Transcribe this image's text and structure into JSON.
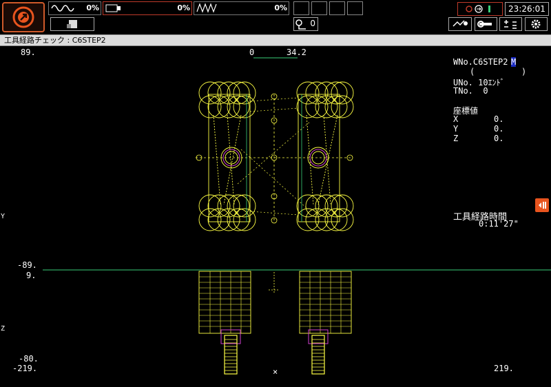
{
  "topbar": {
    "meter1_pct": "0%",
    "meter2_pct": "0%",
    "meter3_pct": "0%",
    "counter": "0",
    "clock": "23:26:01",
    "icons": [
      "program-start-icon",
      "sine-wave-icon",
      "spindle-icon",
      "zigzag-icon",
      "paper-icon",
      "key-icon",
      "status-icon",
      "navigation-icon",
      "wrench-icon",
      "calculator-icon",
      "gear-icon"
    ]
  },
  "titlebar": {
    "title": "工具経路チェック : C6STEP2"
  },
  "graph": {
    "top_left": "89.",
    "top_center_left": "0",
    "top_center_right": "34.2",
    "y_axis": "Y",
    "z_axis": "Z",
    "plane_low": "-89.",
    "z_top": "9.",
    "z_bottom": "-80.",
    "x_left": "-219.",
    "x_right": "219.",
    "origin_mark": "×"
  },
  "info": {
    "wno_label": "WNo.C6STEP2",
    "wno_cursor": "M",
    "paren_open": "(",
    "paren_close": ")",
    "uno": "UNo. 10ｴﾝﾄﾞ",
    "tno": "TNo.  0",
    "coord_title": "座標値",
    "x_label": "X",
    "x_value": "0.",
    "y_label": "Y",
    "y_value": "0.",
    "z_label": "Z",
    "z_value": "0.",
    "time_title": "工具経路時間",
    "time_value": "0:11'27\""
  },
  "colors": {
    "accent": "#e8541e",
    "path": "#ffff44",
    "green": "#3ad07a",
    "magenta": "#d040d0"
  }
}
